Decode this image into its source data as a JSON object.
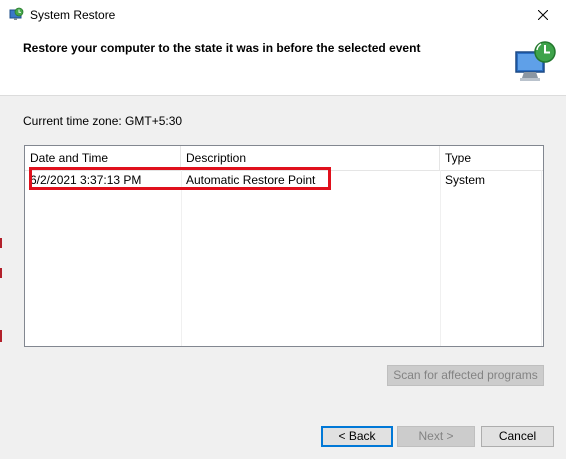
{
  "window": {
    "title": "System Restore",
    "header_text": "Restore your computer to the state it was in before the selected event"
  },
  "timezone_label": "Current time zone: GMT+5:30",
  "table": {
    "columns": [
      "Date and Time",
      "Description",
      "Type"
    ],
    "rows": [
      {
        "date": "6/2/2021 3:37:13 PM",
        "description": "Automatic Restore Point",
        "type": "System"
      }
    ]
  },
  "buttons": {
    "scan": "Scan for affected programs",
    "back": "< Back",
    "next": "Next >",
    "cancel": "Cancel"
  },
  "colors": {
    "highlight": "#e0101c",
    "accent": "#0078d7"
  }
}
